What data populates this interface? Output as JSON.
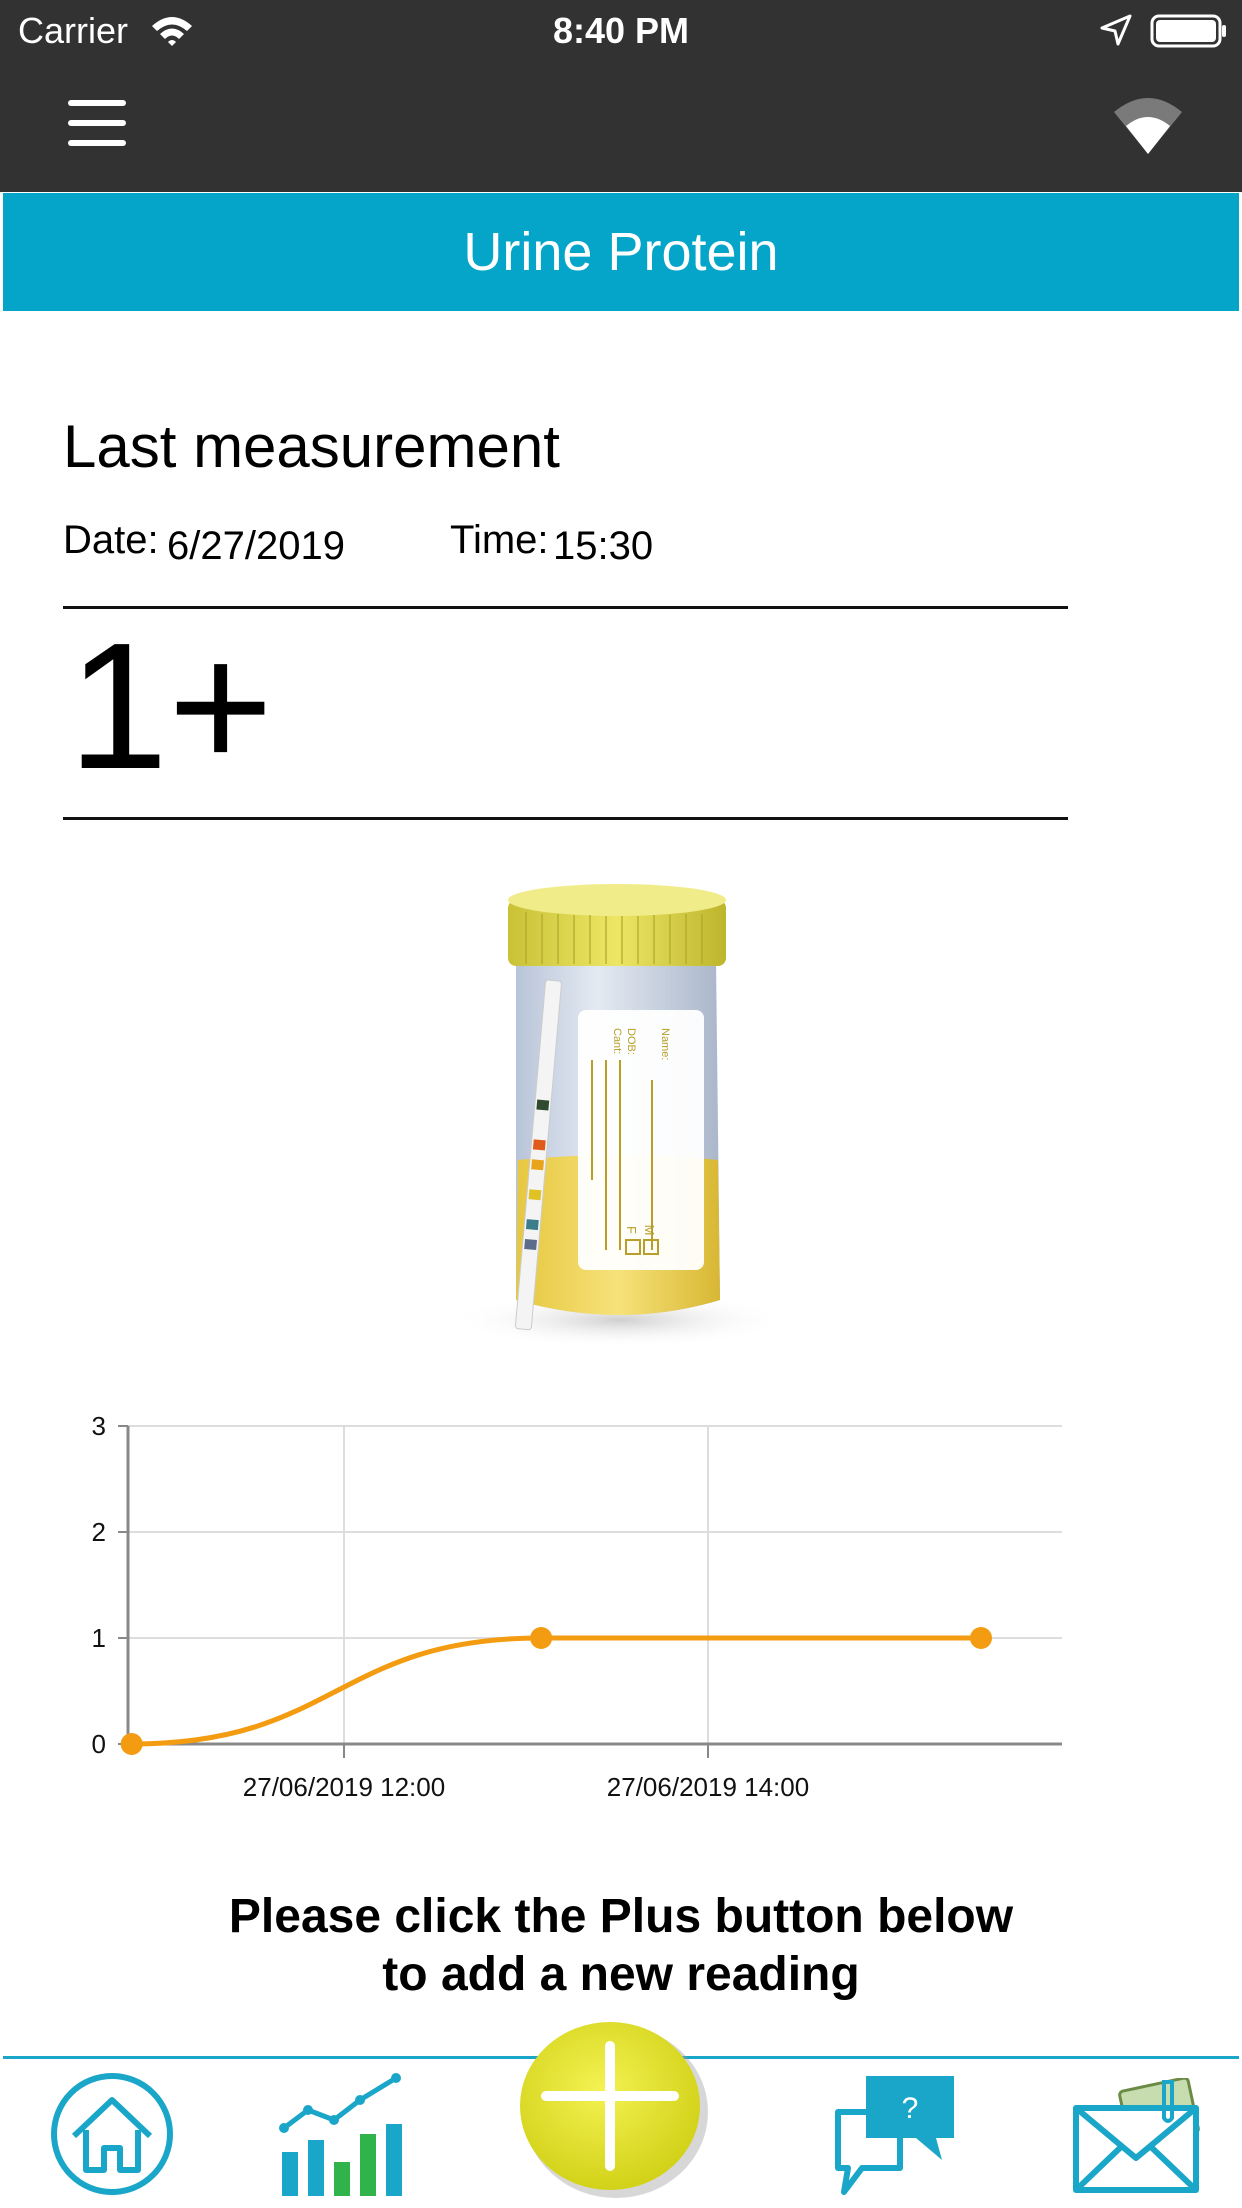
{
  "status_bar": {
    "carrier": "Carrier",
    "time": "8:40 PM"
  },
  "nav": {
    "menu_icon": "hamburger-menu-icon",
    "connection_icon": "signal-icon"
  },
  "title": "Urine Protein",
  "measurement": {
    "heading": "Last measurement",
    "date_label": "Date:",
    "date_value": "6/27/2019",
    "time_label": "Time:",
    "time_value": "15:30",
    "reading": "1+"
  },
  "jar_label": {
    "name": "Name:",
    "dob": "DOB:",
    "cant": "Cant:",
    "m": "M",
    "f": "F"
  },
  "chart_data": {
    "type": "line",
    "x": [
      "27/06/2019 10:50",
      "27/06/2019 13:05",
      "27/06/2019 15:30"
    ],
    "y": [
      0,
      1,
      1
    ],
    "x_tick_labels": [
      "27/06/2019 12:00",
      "27/06/2019 14:00"
    ],
    "y_tick_labels": [
      "0",
      "1",
      "2",
      "3"
    ],
    "ylim": [
      0,
      3
    ],
    "grid": true,
    "line_color": "#f39c12"
  },
  "prompt": {
    "line1": "Please click the Plus button below",
    "line2": "to add a new reading"
  },
  "tabs": {
    "home_icon": "home-icon",
    "stats_icon": "statistics-icon",
    "add_icon": "plus-icon",
    "help_icon": "help-chat-icon",
    "mail_icon": "mail-icon"
  },
  "colors": {
    "accent": "#05a5c9",
    "header": "#323232",
    "chart_line": "#f39c12",
    "add_button": "#e8e81c"
  }
}
